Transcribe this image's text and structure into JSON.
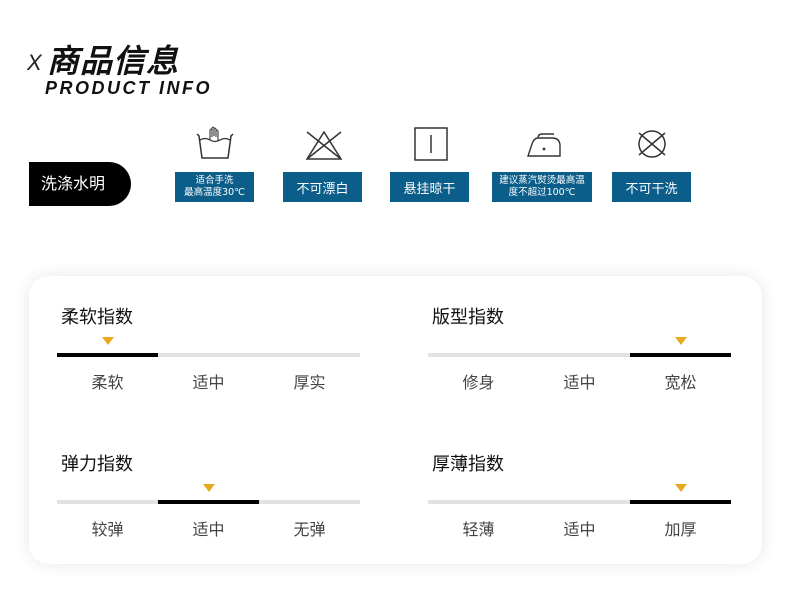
{
  "header": {
    "x_mark": "X",
    "title_cn": "商品信息",
    "title_en": "PRODUCT INFO"
  },
  "care": {
    "tag": "洗涤水明",
    "items": [
      {
        "icon": "hand-wash-icon",
        "label": "适合手洗\n最高温度30℃"
      },
      {
        "icon": "no-bleach-icon",
        "label": "不可漂白"
      },
      {
        "icon": "hang-dry-icon",
        "label": "悬挂晾干"
      },
      {
        "icon": "iron-icon",
        "label": "建议蒸汽熨烫最高温\n度不超过100℃"
      },
      {
        "icon": "no-dry-clean-icon",
        "label": "不可干洗"
      }
    ],
    "label_color": "#0b5d8a"
  },
  "indices": [
    {
      "name": "柔软指数",
      "options": [
        "柔软",
        "适中",
        "厚实"
      ],
      "selected": 0
    },
    {
      "name": "版型指数",
      "options": [
        "修身",
        "适中",
        "宽松"
      ],
      "selected": 2
    },
    {
      "name": "弹力指数",
      "options": [
        "较弹",
        "适中",
        "无弹"
      ],
      "selected": 1
    },
    {
      "name": "厚薄指数",
      "options": [
        "轻薄",
        "适中",
        "加厚"
      ],
      "selected": 2
    }
  ],
  "colors": {
    "marker": "#e9a91f",
    "track": "#e2e2e2",
    "fill": "#000000"
  }
}
